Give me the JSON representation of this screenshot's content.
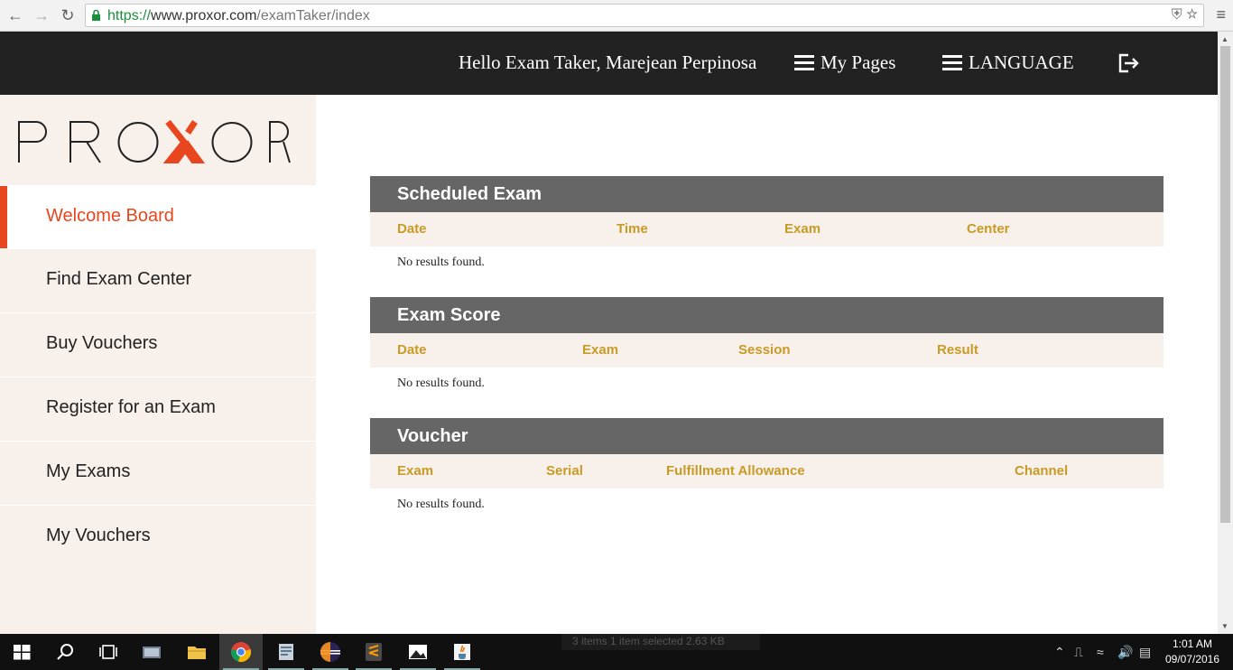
{
  "browser": {
    "url_scheme": "https://",
    "url_host": "www.proxor.com",
    "url_path": "/examTaker/index"
  },
  "header": {
    "greeting": "Hello Exam Taker, Marejean Perpinosa",
    "my_pages": "My Pages",
    "language": "LANGUAGE"
  },
  "sidebar": {
    "logo_text": "PROXOR",
    "items": [
      {
        "label": "Welcome Board"
      },
      {
        "label": "Find Exam Center"
      },
      {
        "label": "Buy Vouchers"
      },
      {
        "label": "Register for an Exam"
      },
      {
        "label": "My Exams"
      },
      {
        "label": "My Vouchers"
      }
    ]
  },
  "sections": {
    "scheduled": {
      "title": "Scheduled Exam",
      "columns": [
        "Date",
        "Time",
        "Exam",
        "Center"
      ],
      "empty": "No results found."
    },
    "score": {
      "title": "Exam Score",
      "columns": [
        "Date",
        "Exam",
        "Session",
        "Result"
      ],
      "empty": "No results found."
    },
    "voucher": {
      "title": "Voucher",
      "columns": [
        "Exam",
        "Serial",
        "Fulfillment Allowance",
        "Channel"
      ],
      "empty": "No results found."
    }
  },
  "taskbar": {
    "explorer_status": "3 items    1 item selected  2.63 KB",
    "time": "1:01 AM",
    "date": "09/07/2016"
  },
  "colors": {
    "accent": "#e8461e",
    "header_bg": "#222222",
    "section_title_bg": "#666666",
    "column_text": "#c89a26",
    "sidebar_bg": "#f8f0ea"
  }
}
